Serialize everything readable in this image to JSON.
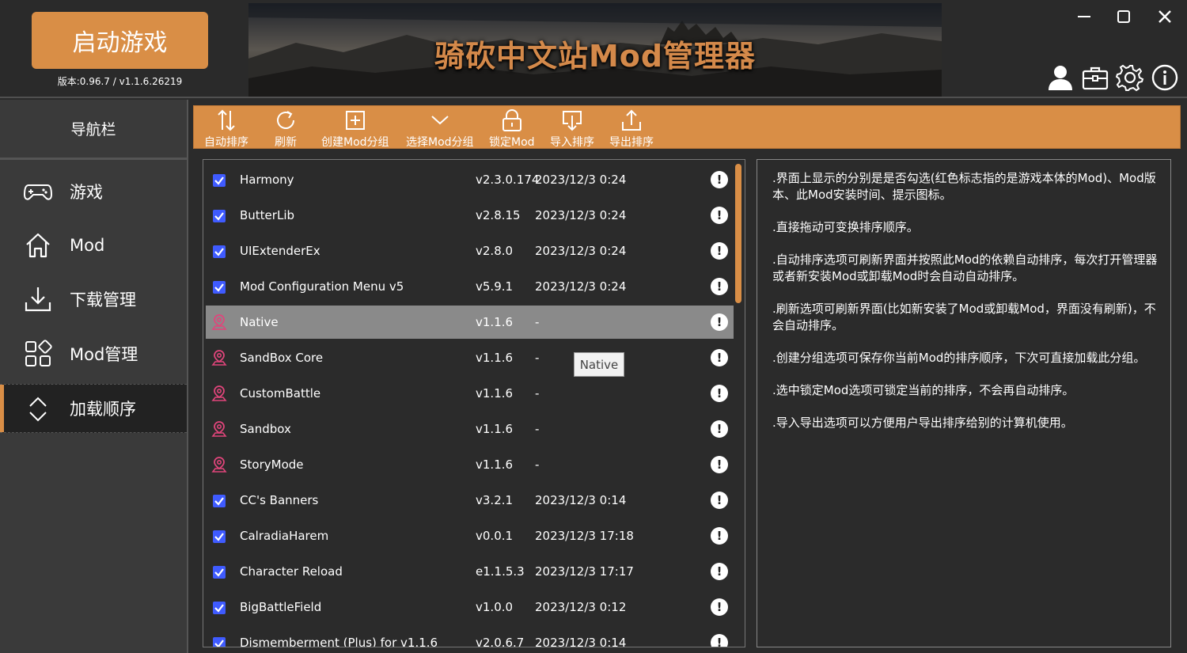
{
  "header": {
    "launch_label": "启动游戏",
    "version": "版本:0.96.7 / v1.1.6.26219",
    "banner_title": "骑砍中文站Mod管理器"
  },
  "window_controls": [
    "minimize-icon",
    "maximize-icon",
    "close-icon"
  ],
  "header_icons": [
    "user-icon",
    "toolbox-icon",
    "gear-icon",
    "info-icon"
  ],
  "sidebar": {
    "title": "导航栏",
    "items": [
      {
        "label": "游戏",
        "icon": "gamepad-icon",
        "active": false
      },
      {
        "label": "Mod",
        "icon": "home-icon",
        "active": false
      },
      {
        "label": "下载管理",
        "icon": "download-icon",
        "active": false
      },
      {
        "label": "Mod管理",
        "icon": "grid-icon",
        "active": false
      },
      {
        "label": "加载顺序",
        "icon": "sort-icon",
        "active": true
      }
    ]
  },
  "toolbar": {
    "buttons": [
      {
        "label": "自动排序",
        "icon": "auto-sort-icon"
      },
      {
        "label": "刷新",
        "icon": "refresh-icon"
      },
      {
        "label": "创建Mod分组",
        "icon": "create-group-icon"
      },
      {
        "label": "选择Mod分组",
        "icon": "chevron-down-icon"
      },
      {
        "label": "锁定Mod",
        "icon": "lock-icon"
      },
      {
        "label": "导入排序",
        "icon": "import-icon"
      },
      {
        "label": "导出排序",
        "icon": "export-icon"
      }
    ]
  },
  "mods": [
    {
      "name": "Harmony",
      "version": "v2.3.0.174",
      "date": "2023/12/3 0:24",
      "kind": "checkbox"
    },
    {
      "name": "ButterLib",
      "version": "v2.8.15",
      "date": "2023/12/3 0:24",
      "kind": "checkbox"
    },
    {
      "name": "UIExtenderEx",
      "version": "v2.8.0",
      "date": "2023/12/3 0:24",
      "kind": "checkbox"
    },
    {
      "name": "Mod Configuration Menu v5",
      "version": "v5.9.1",
      "date": "2023/12/3 0:24",
      "kind": "checkbox"
    },
    {
      "name": "Native",
      "version": "v1.1.6",
      "date": "-",
      "kind": "official",
      "selected": true
    },
    {
      "name": "SandBox Core",
      "version": "v1.1.6",
      "date": "-",
      "kind": "official"
    },
    {
      "name": "CustomBattle",
      "version": "v1.1.6",
      "date": "-",
      "kind": "official"
    },
    {
      "name": "Sandbox",
      "version": "v1.1.6",
      "date": "-",
      "kind": "official"
    },
    {
      "name": "StoryMode",
      "version": "v1.1.6",
      "date": "-",
      "kind": "official"
    },
    {
      "name": "CC's Banners",
      "version": "v3.2.1",
      "date": "2023/12/3 0:14",
      "kind": "checkbox"
    },
    {
      "name": "CalradiaHarem",
      "version": "v0.0.1",
      "date": "2023/12/3 17:18",
      "kind": "checkbox"
    },
    {
      "name": "Character Reload",
      "version": "e1.1.5.3",
      "date": "2023/12/3 17:17",
      "kind": "checkbox"
    },
    {
      "name": "BigBattleField",
      "version": "v1.0.0",
      "date": "2023/12/3 0:12",
      "kind": "checkbox"
    },
    {
      "name": "Dismemberment (Plus) for v1.1.6",
      "version": "v2.0.6.7",
      "date": "2023/12/3 0:14",
      "kind": "checkbox"
    }
  ],
  "tooltip": "Native",
  "help": [
    ".界面上显示的分别是是否勾选(红色标志指的是游戏本体的Mod)、Mod版本、此Mod安装时间、提示图标。",
    ".直接拖动可变换排序顺序。",
    ".自动排序选项可刷新界面并按照此Mod的依赖自动排序，每次打开管理器或者新安装Mod或卸载Mod时会自动自动排序。",
    ".刷新选项可刷新界面(比如新安装了Mod或卸载Mod，界面没有刷新)，不会自动排序。",
    ".创建分组选项可保存你当前Mod的排序顺序，下次可直接加载此分组。",
    ".选中锁定Mod选项可锁定当前的排序，不会再自动排序。",
    ".导入导出选项可以方便用户导出排序给别的计算机使用。"
  ],
  "colors": {
    "accent": "#d98e46",
    "checkbox": "#3f5bff",
    "official_marker": "#e0457b",
    "background": "#2b2b2b"
  }
}
